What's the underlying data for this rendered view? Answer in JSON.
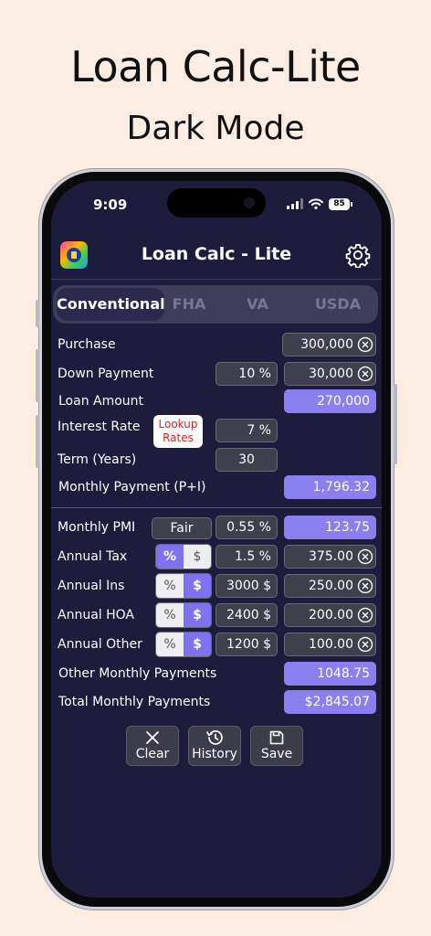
{
  "promo": {
    "title": "Loan Calc-Lite",
    "subtitle": "Dark Mode"
  },
  "status": {
    "time": "9:09",
    "battery": "85"
  },
  "nav": {
    "title": "Loan Calc - Lite",
    "logo_icon": "app-logo-icon",
    "settings_icon": "gear-icon"
  },
  "tabs": [
    {
      "label": "Conventional",
      "active": true
    },
    {
      "label": "FHA",
      "active": false
    },
    {
      "label": "VA",
      "active": false
    },
    {
      "label": "USDA",
      "active": false
    }
  ],
  "loan": {
    "purchase": {
      "label": "Purchase",
      "value": "300,000"
    },
    "down": {
      "label": "Down Payment",
      "percent": "10 %",
      "value": "30,000"
    },
    "amount": {
      "label": "Loan Amount",
      "value": "270,000"
    },
    "rate": {
      "label": "Interest Rate",
      "lookup": "Lookup Rates",
      "value": "7 %"
    },
    "term": {
      "label": "Term (Years)",
      "value": "30"
    },
    "monthly": {
      "label": "Monthly Payment (P+I)",
      "value": "1,796.32"
    }
  },
  "extras": {
    "pmi": {
      "label": "Monthly PMI",
      "grade": "Fair",
      "rate": "0.55 %",
      "value": "123.75"
    },
    "tax": {
      "label": "Annual Tax",
      "mode": "%",
      "input": "1.5 %",
      "value": "375.00"
    },
    "ins": {
      "label": "Annual Ins",
      "mode": "$",
      "input": "3000 $",
      "value": "250.00"
    },
    "hoa": {
      "label": "Annual HOA",
      "mode": "$",
      "input": "2400 $",
      "value": "200.00"
    },
    "other": {
      "label": "Annual Other",
      "mode": "$",
      "input": "1200 $",
      "value": "100.00"
    },
    "toggle_pct": "%",
    "toggle_usd": "$"
  },
  "totals": {
    "other_monthly": {
      "label": "Other Monthly Payments",
      "value": "1048.75"
    },
    "total_monthly": {
      "label": "Total Monthly Payments",
      "value": "$2,845.07"
    }
  },
  "actions": {
    "clear": "Clear",
    "history": "History",
    "save": "Save"
  },
  "colors": {
    "accent": "#8a7fef",
    "background": "#1d1c3c",
    "page": "#fcede3",
    "lookup_text": "#e02020"
  }
}
